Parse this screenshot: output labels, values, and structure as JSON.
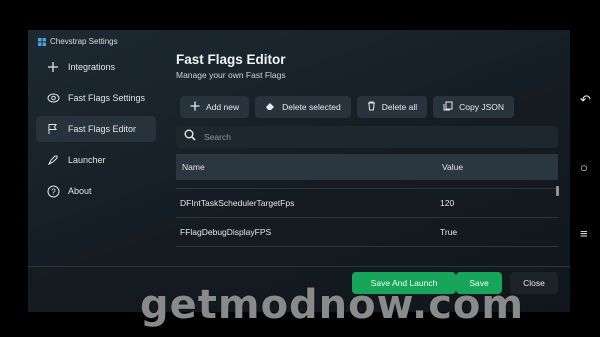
{
  "app": {
    "title": "Chevstrap Settings"
  },
  "sidebar": {
    "items": [
      {
        "label": "Integrations",
        "icon": "plus-icon"
      },
      {
        "label": "Fast Flags Settings",
        "icon": "eye-icon"
      },
      {
        "label": "Fast Flags Editor",
        "icon": "flag-icon"
      },
      {
        "label": "Launcher",
        "icon": "rocket-icon"
      },
      {
        "label": "About",
        "icon": "help-icon"
      }
    ],
    "active_index": 2
  },
  "main": {
    "title": "Fast Flags Editor",
    "subtitle": "Manage your own Fast Flags"
  },
  "toolbar": {
    "add_label": "Add new",
    "delete_selected_label": "Delete selected",
    "delete_all_label": "Delete all",
    "copy_json_label": "Copy JSON"
  },
  "search": {
    "placeholder": "Search"
  },
  "table": {
    "headers": {
      "name": "Name",
      "value": "Value"
    },
    "rows": [
      {
        "name": "DFIntTaskSchedulerTargetFps",
        "value": "120"
      },
      {
        "name": "FFlagDebugDisplayFPS",
        "value": "True"
      }
    ]
  },
  "footer": {
    "save_launch_label": "Save And Launch",
    "save_label": "Save",
    "close_label": "Close"
  },
  "watermark": {
    "text": "getmodnow.com"
  },
  "colors": {
    "accent": "#17a55a",
    "background": "#141c22"
  }
}
